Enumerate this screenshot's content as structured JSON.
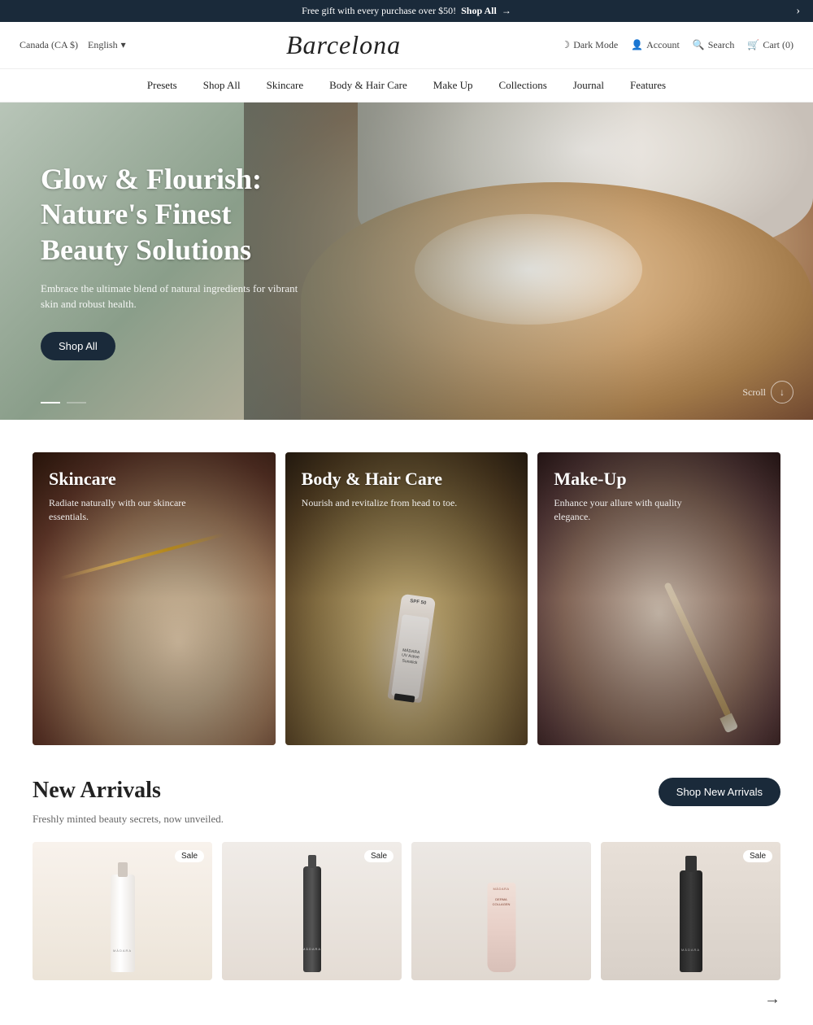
{
  "announcement": {
    "text": "Free gift with every purchase over $50!",
    "cta": "Shop All",
    "arrow": "›"
  },
  "topnav": {
    "country": "Canada (CA $)",
    "language": "English",
    "lang_arrow": "▾",
    "logo": "Barcelona",
    "dark_mode": "Dark Mode",
    "account": "Account",
    "search": "Search",
    "cart": "Cart (0)"
  },
  "mainnav": {
    "items": [
      {
        "label": "Presets"
      },
      {
        "label": "Shop All"
      },
      {
        "label": "Skincare"
      },
      {
        "label": "Body & Hair Care"
      },
      {
        "label": "Make Up"
      },
      {
        "label": "Collections"
      },
      {
        "label": "Journal"
      },
      {
        "label": "Features"
      }
    ]
  },
  "hero": {
    "title": "Glow & Flourish: Nature's Finest Beauty Solutions",
    "subtitle": "Embrace the ultimate blend of natural ingredients for vibrant skin and robust health.",
    "cta": "Shop All",
    "scroll": "Scroll"
  },
  "categories": [
    {
      "title": "Skincare",
      "subtitle": "Radiate naturally with our skincare essentials.",
      "type": "skincare"
    },
    {
      "title": "Body & Hair Care",
      "subtitle": "Nourish and revitalize from head to toe.",
      "type": "bodycare"
    },
    {
      "title": "Make-Up",
      "subtitle": "Enhance your allure with quality elegance.",
      "type": "makeup"
    }
  ],
  "new_arrivals": {
    "title": "New Arrivals",
    "subtitle": "Freshly minted beauty secrets, now unveiled.",
    "cta": "Shop New Arrivals",
    "products": [
      {
        "sale": true,
        "name": "MÁDARA",
        "type": "bottle-white",
        "bg": "light"
      },
      {
        "sale": true,
        "name": "MÁDARA",
        "type": "bottle-dark-slim",
        "bg": "light"
      },
      {
        "sale": false,
        "name": "MÁDARA",
        "type": "tube-pink",
        "bg": "light"
      },
      {
        "sale": true,
        "name": "MÁDARA",
        "type": "bottle-black",
        "bg": "light"
      }
    ],
    "arrow": "→"
  }
}
